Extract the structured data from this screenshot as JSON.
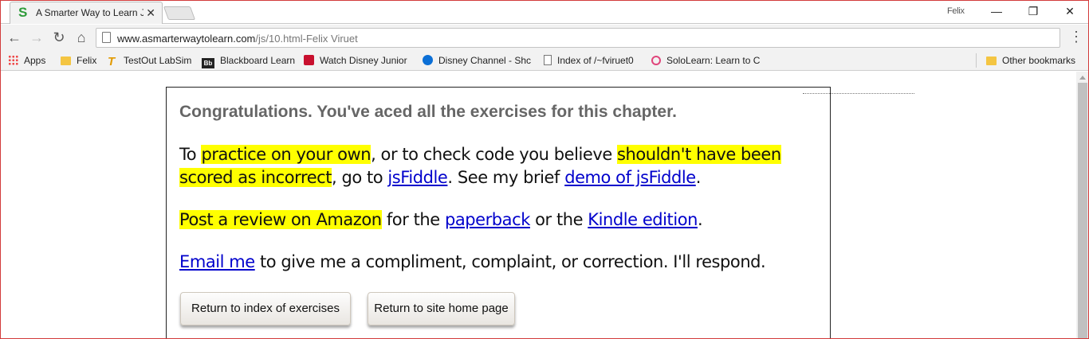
{
  "browser": {
    "tab_title": "A Smarter Way to Learn J",
    "tab_favicon": "S",
    "tab_close": "✕",
    "profile_name": "Felix",
    "window_controls": {
      "minimize": "—",
      "maximize": "❐",
      "close": "✕"
    },
    "nav": {
      "back": "←",
      "forward": "→",
      "reload": "↻",
      "home": "⌂"
    },
    "url_host": "www.asmarterwaytolearn.com",
    "url_path": "/js/10.html-Felix Viruet",
    "menu": "⋮",
    "bookmarks": [
      {
        "icon": "apps-icon",
        "label": "Apps"
      },
      {
        "icon": "folder-icon",
        "label": "Felix"
      },
      {
        "icon": "testout-icon",
        "label": "TestOut LabSim"
      },
      {
        "icon": "blackboard-icon",
        "label": "Blackboard Learn"
      },
      {
        "icon": "disney-junior-icon",
        "label": "Watch Disney Junior"
      },
      {
        "icon": "disney-channel-icon",
        "label": "Disney Channel - Shc"
      },
      {
        "icon": "document-icon",
        "label": "Index of /~fviruet0"
      },
      {
        "icon": "sololearn-icon",
        "label": "SoloLearn: Learn to C"
      }
    ],
    "other_bookmarks": "Other bookmarks",
    "icon_glyphs": {
      "testout": "T",
      "blackboard": "Bb"
    }
  },
  "page": {
    "congrats": "Congratulations. You've aced all the exercises for this chapter.",
    "p1": {
      "t1": "To ",
      "h1": "practice on your own",
      "t2": ", or to check code you believe ",
      "h2": "shouldn't have been scored as incorrect",
      "t3": ", go to ",
      "l1": "jsFiddle",
      "t4": ". See my brief ",
      "l2": "demo of jsFiddle",
      "t5": "."
    },
    "p2": {
      "h1": "Post a review on Amazon",
      "t1": " for the ",
      "l1": "paperback",
      "t2": " or the ",
      "l2": "Kindle edition",
      "t3": "."
    },
    "p3": {
      "l1": "Email me",
      "t1": " to give me a compliment, complaint, or correction. I'll respond."
    },
    "buttons": {
      "index": "Return to index of exercises",
      "home": "Return to site home page"
    }
  },
  "colors": {
    "highlight": "#ffff00",
    "link": "#0000cc",
    "favicon": "#2e9b3a"
  }
}
